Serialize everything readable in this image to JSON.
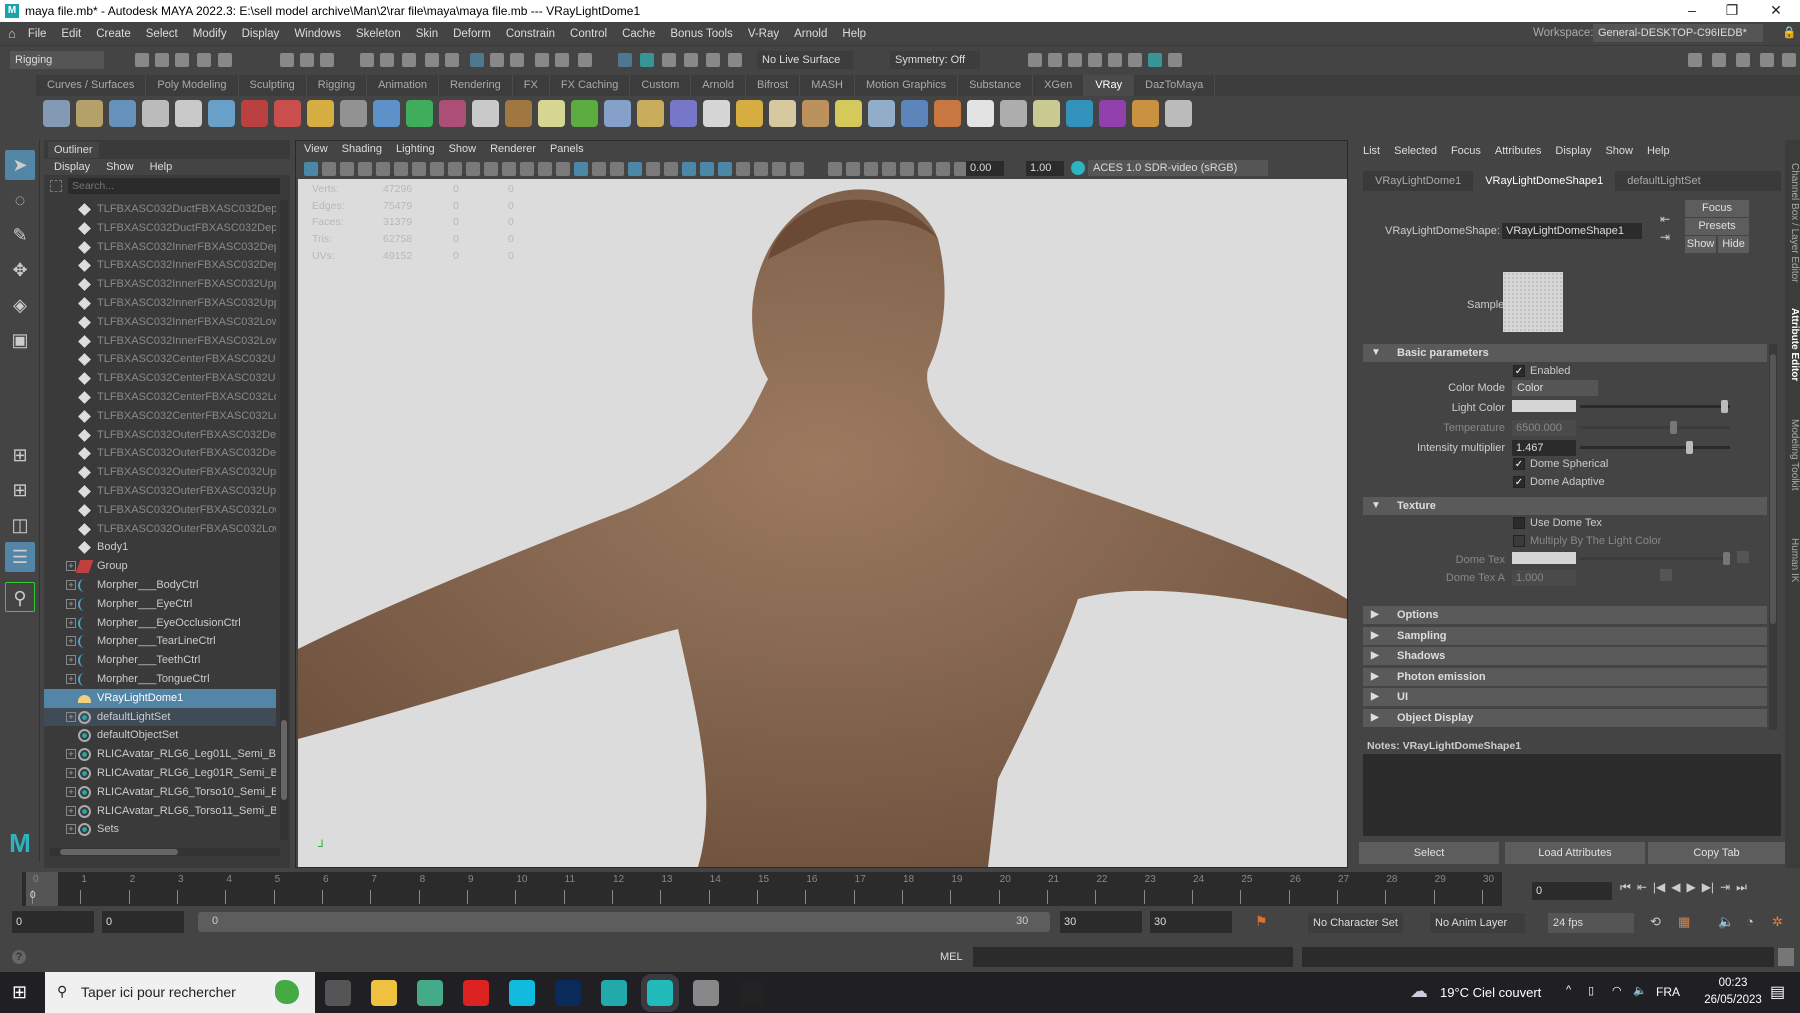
{
  "window": {
    "title": "maya file.mb* - Autodesk MAYA 2022.3: E:\\sell model archive\\Man\\2\\rar file\\maya\\maya file.mb  ---  VRayLightDome1",
    "minimize": "–",
    "maximize": "❐",
    "close": "✕"
  },
  "menu": [
    "File",
    "Edit",
    "Create",
    "Select",
    "Modify",
    "Display",
    "Windows",
    "Skeleton",
    "Skin",
    "Deform",
    "Constrain",
    "Control",
    "Cache",
    "Bonus Tools",
    "V-Ray",
    "Arnold",
    "Help"
  ],
  "workspace": {
    "label": "Workspace:",
    "value": "General-DESKTOP-C96IEDB*"
  },
  "statusline": {
    "mode": "Rigging",
    "live_surface": "No Live Surface",
    "symmetry": "Symmetry: Off"
  },
  "shelf_tabs": [
    "Curves / Surfaces",
    "Poly Modeling",
    "Sculpting",
    "Rigging",
    "Animation",
    "Rendering",
    "FX",
    "FX Caching",
    "Custom",
    "Arnold",
    "Bifrost",
    "MASH",
    "Motion Graphics",
    "Substance",
    "XGen",
    "VRay",
    "DazToMaya"
  ],
  "shelf_active_tab": "VRay",
  "shelf_icon_colors": [
    "#8fa8c8",
    "#c8b070",
    "#6aa0d0",
    "#d0d0d0",
    "#e0e0e0",
    "#70b0e0",
    "#d04040",
    "#e05050",
    "#f0c040",
    "#a0a0a0",
    "#60a0e0",
    "#40c060",
    "#c05080",
    "#e0e0e0",
    "#b08040",
    "#f0f0a0",
    "#60c040",
    "#90b0e0",
    "#e0c060",
    "#8080e0",
    "#f0f0f0",
    "#f0c040",
    "#f0e0b0",
    "#d0a060",
    "#f0e060",
    "#a0c0e0",
    "#6090d0",
    "#e08040",
    "#ffffff",
    "#c0c0c0",
    "#e0e0a0",
    "#30a0d0",
    "#a040c0",
    "#e0a040",
    "#d0d0d0"
  ],
  "outliner": {
    "title": "Outliner",
    "menu": [
      "Display",
      "Show",
      "Help"
    ],
    "search_placeholder": "Search...",
    "items": [
      {
        "label": "TLFBXASC032DuctFBXASC032DepthFE",
        "icon": "transform-icon",
        "expand": false,
        "dim": true
      },
      {
        "label": "TLFBXASC032DuctFBXASC032DepthFE",
        "icon": "transform-icon",
        "expand": false,
        "dim": true
      },
      {
        "label": "TLFBXASC032InnerFBXASC032DepthFl",
        "icon": "transform-icon",
        "expand": false,
        "dim": true
      },
      {
        "label": "TLFBXASC032InnerFBXASC032DepthFl",
        "icon": "transform-icon",
        "expand": false,
        "dim": true
      },
      {
        "label": "TLFBXASC032InnerFBXASC032UpperFl",
        "icon": "transform-icon",
        "expand": false,
        "dim": true
      },
      {
        "label": "TLFBXASC032InnerFBXASC032UpperFl",
        "icon": "transform-icon",
        "expand": false,
        "dim": true
      },
      {
        "label": "TLFBXASC032InnerFBXASC032LowerFl",
        "icon": "transform-icon",
        "expand": false,
        "dim": true
      },
      {
        "label": "TLFBXASC032InnerFBXASC032LowerFl",
        "icon": "transform-icon",
        "expand": false,
        "dim": true
      },
      {
        "label": "TLFBXASC032CenterFBXASC032Upper",
        "icon": "transform-icon",
        "expand": false,
        "dim": true
      },
      {
        "label": "TLFBXASC032CenterFBXASC032Upper",
        "icon": "transform-icon",
        "expand": false,
        "dim": true
      },
      {
        "label": "TLFBXASC032CenterFBXASC032Lowerl",
        "icon": "transform-icon",
        "expand": false,
        "dim": true
      },
      {
        "label": "TLFBXASC032CenterFBXASC032Lowerl",
        "icon": "transform-icon",
        "expand": false,
        "dim": true
      },
      {
        "label": "TLFBXASC032OuterFBXASC032DepthF",
        "icon": "transform-icon",
        "expand": false,
        "dim": true
      },
      {
        "label": "TLFBXASC032OuterFBXASC032DepthF",
        "icon": "transform-icon",
        "expand": false,
        "dim": true
      },
      {
        "label": "TLFBXASC032OuterFBXASC032UpperF",
        "icon": "transform-icon",
        "expand": false,
        "dim": true
      },
      {
        "label": "TLFBXASC032OuterFBXASC032UpperF",
        "icon": "transform-icon",
        "expand": false,
        "dim": true
      },
      {
        "label": "TLFBXASC032OuterFBXASC032LowerF",
        "icon": "transform-icon",
        "expand": false,
        "dim": true
      },
      {
        "label": "TLFBXASC032OuterFBXASC032LowerF",
        "icon": "transform-icon",
        "expand": false,
        "dim": true
      },
      {
        "label": "Body1",
        "icon": "transform-icon",
        "expand": false
      },
      {
        "label": "Group",
        "icon": "group-icon",
        "expand": true
      },
      {
        "label": "Morpher___BodyCtrl",
        "icon": "curve-icon",
        "expand": true
      },
      {
        "label": "Morpher___EyeCtrl",
        "icon": "curve-icon",
        "expand": true
      },
      {
        "label": "Morpher___EyeOcclusionCtrl",
        "icon": "curve-icon",
        "expand": true
      },
      {
        "label": "Morpher___TearLineCtrl",
        "icon": "curve-icon",
        "expand": true
      },
      {
        "label": "Morpher___TeethCtrl",
        "icon": "curve-icon",
        "expand": true
      },
      {
        "label": "Morpher___TongueCtrl",
        "icon": "curve-icon",
        "expand": true
      },
      {
        "label": "VRayLightDome1",
        "icon": "dome-light-icon",
        "expand": false,
        "selected": true
      },
      {
        "label": "defaultLightSet",
        "icon": "set-icon",
        "expand": true,
        "highlight": true
      },
      {
        "label": "defaultObjectSet",
        "icon": "set-icon",
        "expand": false
      },
      {
        "label": "RLICAvatar_RLG6_Leg01L_Semi_Boxers",
        "icon": "set-icon",
        "expand": true
      },
      {
        "label": "RLICAvatar_RLG6_Leg01R_Semi_Boxer",
        "icon": "set-icon",
        "expand": true
      },
      {
        "label": "RLICAvatar_RLG6_Torso10_Semi_Boxer",
        "icon": "set-icon",
        "expand": true
      },
      {
        "label": "RLICAvatar_RLG6_Torso11_Semi_Boxer",
        "icon": "set-icon",
        "expand": true
      },
      {
        "label": "Sets",
        "icon": "set-icon",
        "expand": true
      }
    ]
  },
  "viewport": {
    "menu": [
      "View",
      "Shading",
      "Lighting",
      "Show",
      "Renderer",
      "Panels"
    ],
    "exposure": "0.00",
    "gamma": "1.00",
    "color_space": "ACES 1.0 SDR-video (sRGB)",
    "hud": [
      {
        "label": "Verts:",
        "v1": "47296",
        "v2": "0",
        "v3": "0"
      },
      {
        "label": "Edges:",
        "v1": "75479",
        "v2": "0",
        "v3": "0"
      },
      {
        "label": "Faces:",
        "v1": "31379",
        "v2": "0",
        "v3": "0"
      },
      {
        "label": "Tris:",
        "v1": "62758",
        "v2": "0",
        "v3": "0"
      },
      {
        "label": "UVs:",
        "v1": "49152",
        "v2": "0",
        "v3": "0"
      }
    ],
    "background": "#dcdcdc",
    "skin_color": "#8a6a52"
  },
  "attribute_editor": {
    "menu": [
      "List",
      "Selected",
      "Focus",
      "Attributes",
      "Display",
      "Show",
      "Help"
    ],
    "tabs": [
      "VRayLightDome1",
      "VRayLightDomeShape1",
      "defaultLightSet"
    ],
    "active_tab": 1,
    "shape_label": "VRayLightDomeShape:",
    "shape_value": "VRayLightDomeShape1",
    "focus": "Focus",
    "presets": "Presets",
    "show": "Show",
    "hide": "Hide",
    "sample_label": "Sample",
    "basic": {
      "title": "Basic parameters",
      "enabled": {
        "label": "Enabled",
        "checked": true
      },
      "color_mode": {
        "label": "Color Mode",
        "value": "Color"
      },
      "light_color": {
        "label": "Light Color",
        "slider": 0.97
      },
      "temperature": {
        "label": "Temperature",
        "value": "6500.000",
        "slider": 0.62
      },
      "intensity": {
        "label": "Intensity multiplier",
        "value": "1.467",
        "slider": 0.73
      },
      "dome_spherical": {
        "label": "Dome Spherical",
        "checked": true
      },
      "dome_adaptive": {
        "label": "Dome Adaptive",
        "checked": true
      }
    },
    "texture": {
      "title": "Texture",
      "use_dome_tex": {
        "label": "Use Dome Tex",
        "checked": false
      },
      "multiply": {
        "label": "Multiply By The Light Color",
        "checked": false
      },
      "dome_tex": {
        "label": "Dome Tex"
      },
      "dome_tex_a": {
        "label": "Dome Tex A",
        "value": "1.000"
      }
    },
    "collapsed_sections": [
      "Options",
      "Sampling",
      "Shadows",
      "Photon emission",
      "UI",
      "Object Display"
    ],
    "notes_label": "Notes:  VRayLightDomeShape1",
    "buttons": [
      "Select",
      "Load Attributes",
      "Copy Tab"
    ]
  },
  "side_tabs": [
    "Channel Box / Layer Editor",
    "Attribute Editor",
    "Modeling Toolkit",
    "Human IK"
  ],
  "timeline": {
    "start": 0,
    "end": 30,
    "current": "0",
    "current_field": "0"
  },
  "range": {
    "start": "0",
    "inner_start": "0",
    "slider_start": "0",
    "slider_end": "30",
    "inner_end": "30",
    "end": "30",
    "character_set": "No Character Set",
    "anim_layer": "No Anim Layer",
    "fps": "24 fps"
  },
  "command": {
    "lang": "MEL"
  },
  "taskbar": {
    "search": "Taper ici pour rechercher",
    "weather": "19°C  Ciel couvert",
    "lang": "FRA",
    "time": "00:23",
    "date": "26/05/2023",
    "apps": [
      "task-view-icon",
      "file-explorer-icon",
      "chrome-icon",
      "opera-icon",
      "c-app-icon",
      "photoshop-icon",
      "maya-icon",
      "maya-active-icon",
      "unity-hub-icon",
      "unity-icon"
    ]
  }
}
